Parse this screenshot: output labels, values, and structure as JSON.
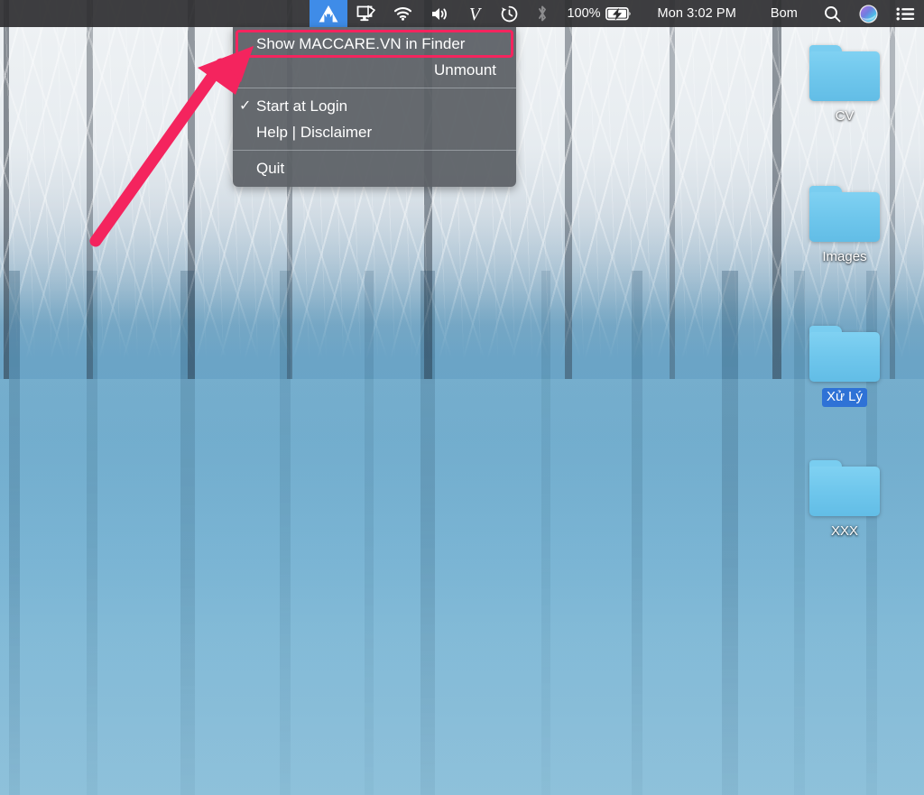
{
  "menubar": {
    "app_icon": "maccare-m-logo-icon",
    "extras": [
      {
        "name": "airplay-display-icon",
        "label": "AirPlay Display"
      },
      {
        "name": "wifi-icon",
        "label": "Wi-Fi"
      },
      {
        "name": "volume-icon",
        "label": "Volume"
      },
      {
        "name": "vietnamese-input-icon",
        "label": "V"
      },
      {
        "name": "time-machine-icon",
        "label": "Time Machine"
      },
      {
        "name": "bluetooth-icon",
        "label": "Bluetooth"
      }
    ],
    "battery_percent": "100%",
    "battery_icon": "battery-charging-icon",
    "clock": "Mon 3:02 PM",
    "user": "Bom",
    "search_icon": "search-icon",
    "siri_icon": "siri-icon",
    "notification_center_icon": "notification-center-icon"
  },
  "status_menu": {
    "items": [
      {
        "label": "Show MACCARE.VN in Finder",
        "checked": false,
        "highlighted": true,
        "align": "left"
      },
      {
        "label": "Unmount",
        "checked": false,
        "highlighted": false,
        "align": "right"
      },
      {
        "label": "Start at Login",
        "checked": true,
        "highlighted": false,
        "align": "left"
      },
      {
        "label": "Help | Disclaimer",
        "checked": false,
        "highlighted": false,
        "align": "left"
      },
      {
        "label": "Quit",
        "checked": false,
        "highlighted": false,
        "align": "left"
      }
    ],
    "checkmark_glyph": "✓",
    "highlight_color": "#f4245e"
  },
  "desktop_icons": [
    {
      "label": "CV",
      "icon": "folder-icon",
      "selected": false
    },
    {
      "label": "Images",
      "icon": "folder-icon",
      "selected": false
    },
    {
      "label": "Xử Lý",
      "icon": "folder-icon",
      "selected": true
    },
    {
      "label": "XXX",
      "icon": "folder-icon",
      "selected": false
    }
  ],
  "annotation": {
    "type": "arrow",
    "color": "#f4245e",
    "points_to": "Show MACCARE.VN in Finder"
  },
  "wallpaper": {
    "name": "blue-pond-winter-wallpaper",
    "accent": "#6ba4c6"
  }
}
